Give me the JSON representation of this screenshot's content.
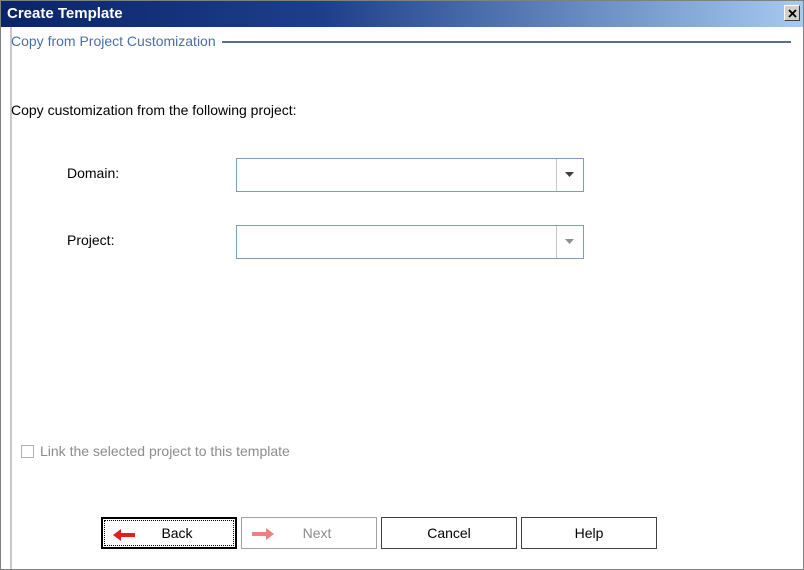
{
  "window": {
    "title": "Create Template"
  },
  "section": {
    "title": "Copy from Project Customization"
  },
  "instruction": "Copy customization from the following project:",
  "fields": {
    "domain": {
      "label": "Domain:",
      "value": ""
    },
    "project": {
      "label": "Project:",
      "value": ""
    }
  },
  "link_checkbox": {
    "label": "Link the selected project to this template",
    "checked": false,
    "enabled": false
  },
  "buttons": {
    "back": "Back",
    "next": "Next",
    "cancel": "Cancel",
    "help": "Help"
  },
  "icons": {
    "close": "close-icon",
    "back": "back-arrow-icon",
    "next": "next-arrow-icon",
    "dropdown": "chevron-down-icon"
  },
  "colors": {
    "title_bar": "#0a246a",
    "section_title": "#4a6fa5",
    "back_arrow": "#e02020",
    "next_arrow": "#f08080",
    "disabled_text": "#8c8c8c"
  }
}
